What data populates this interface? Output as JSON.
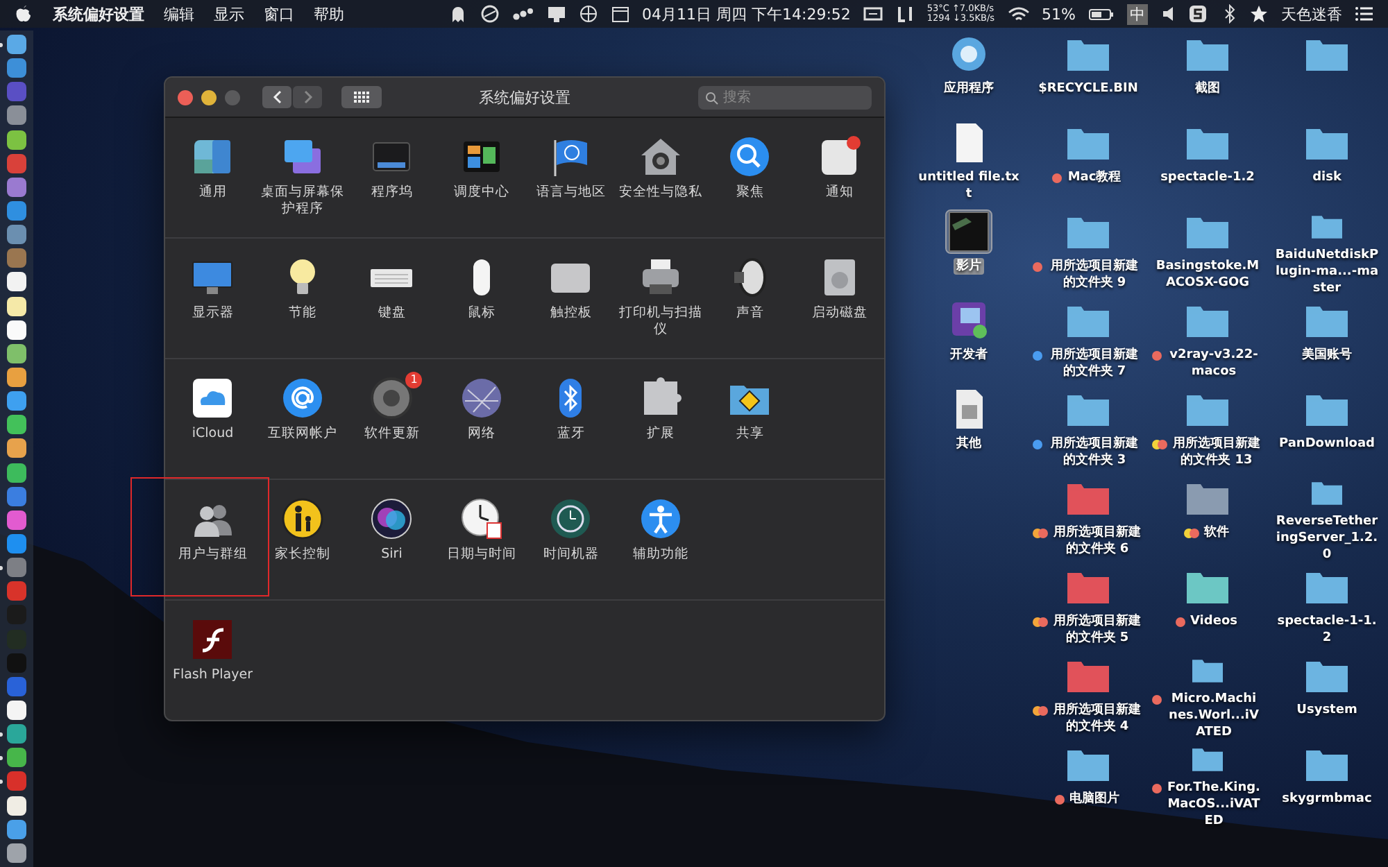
{
  "menu_bar": {
    "menus": [
      "系统偏好设置",
      "编辑",
      "显示",
      "窗口",
      "帮助"
    ],
    "date_time": "04月11日 周四 下午14:29:52",
    "temperature": "53°C",
    "upload": "↑7.0KB/s",
    "fan_speed": "1294",
    "download": "↓3.5KB/s",
    "battery": "51%",
    "input_method": "中",
    "user": "天色迷香"
  },
  "dock": {
    "items": [
      {
        "color": "#5aa9e6",
        "running": true
      },
      {
        "color": "#3d8fd8",
        "running": false
      },
      {
        "color": "#5a4fc4",
        "running": false
      },
      {
        "color": "#8a8f98",
        "running": false
      },
      {
        "color": "#7cc242",
        "running": false
      },
      {
        "color": "#d9413a",
        "running": false
      },
      {
        "color": "#9a7ad0",
        "running": false
      },
      {
        "color": "#2f8fe0",
        "running": false
      },
      {
        "color": "#6b8fb0",
        "running": false
      },
      {
        "color": "#9a7650",
        "running": false
      },
      {
        "color": "#f2f2f2",
        "running": false
      },
      {
        "color": "#f5e9a8",
        "running": false
      },
      {
        "color": "#fafafa",
        "running": false
      },
      {
        "color": "#7fbf6a",
        "running": false
      },
      {
        "color": "#e8a040",
        "running": false
      },
      {
        "color": "#3ea0f0",
        "running": false
      },
      {
        "color": "#43c15a",
        "running": false
      },
      {
        "color": "#e7a24c",
        "running": false
      },
      {
        "color": "#3dbb5c",
        "running": false
      },
      {
        "color": "#3b7ee0",
        "running": false
      },
      {
        "color": "#e25bd0",
        "running": false
      },
      {
        "color": "#1e8ff0",
        "running": false
      },
      {
        "color": "#7d7f85",
        "running": true
      },
      {
        "color": "#d8332a",
        "running": false
      },
      {
        "color": "#1b1b1b",
        "running": false
      },
      {
        "color": "#222d22",
        "running": false
      },
      {
        "color": "#111111",
        "running": false
      },
      {
        "color": "#2962d8",
        "running": false
      },
      {
        "color": "#f4f4f4",
        "running": false
      },
      {
        "color": "#2aa79a",
        "running": true
      },
      {
        "color": "#47b64a",
        "running": true
      },
      {
        "color": "#d8302a",
        "running": true
      },
      {
        "color": "#f0ede4",
        "running": false
      },
      {
        "color": "#4aa0e8",
        "running": false
      },
      {
        "color": "#9ea3aa",
        "running": false
      }
    ]
  },
  "window": {
    "title": "系统偏好设置",
    "traffic_lights": [
      {
        "color": "#ec5f57"
      },
      {
        "color": "#e0b33a"
      },
      {
        "color": "#5a5a5c"
      }
    ],
    "nav_buttons": [
      {
        "kind": "back",
        "disabled": false
      },
      {
        "kind": "forward",
        "disabled": true
      }
    ],
    "search": {
      "placeholder": "搜索"
    },
    "sections": [
      {
        "items": [
          {
            "label": "通用",
            "annotated": false
          },
          {
            "label": "桌面与屏幕保护程序",
            "annotated": false
          },
          {
            "label": "程序坞",
            "annotated": false
          },
          {
            "label": "调度中心",
            "annotated": false
          },
          {
            "label": "语言与地区",
            "annotated": false
          },
          {
            "label": "安全性与隐私",
            "annotated": false
          },
          {
            "label": "聚焦",
            "annotated": false
          },
          {
            "label": "通知",
            "annotated": false
          }
        ]
      },
      {
        "items": [
          {
            "label": "显示器",
            "annotated": false
          },
          {
            "label": "节能",
            "annotated": false
          },
          {
            "label": "键盘",
            "annotated": false
          },
          {
            "label": "鼠标",
            "annotated": false
          },
          {
            "label": "触控板",
            "annotated": false
          },
          {
            "label": "打印机与扫描仪",
            "annotated": false
          },
          {
            "label": "声音",
            "annotated": false
          },
          {
            "label": "启动磁盘",
            "annotated": false
          }
        ]
      },
      {
        "items": [
          {
            "label": "iCloud",
            "annotated": false
          },
          {
            "label": "互联网帐户",
            "annotated": false
          },
          {
            "label": "软件更新",
            "badge": "1",
            "annotated": false
          },
          {
            "label": "网络",
            "annotated": false
          },
          {
            "label": "蓝牙",
            "annotated": false
          },
          {
            "label": "扩展",
            "annotated": false
          },
          {
            "label": "共享",
            "annotated": false
          }
        ]
      },
      {
        "items": [
          {
            "label": "用户与群组",
            "annotated": true
          },
          {
            "label": "家长控制",
            "annotated": false
          },
          {
            "label": "Siri",
            "annotated": false
          },
          {
            "label": "日期与时间",
            "annotated": false
          },
          {
            "label": "时间机器",
            "annotated": false
          },
          {
            "label": "辅助功能",
            "annotated": false
          }
        ]
      },
      {
        "items": [
          {
            "label": "Flash Player",
            "annotated": false
          }
        ]
      }
    ]
  },
  "desktop": {
    "columns": [
      {
        "items": [
          {
            "kind": "applications",
            "label": "应用程序",
            "selected": false
          },
          {
            "kind": "text-file",
            "label": "untitled file.txt",
            "selected": false
          },
          {
            "kind": "movie",
            "label": "影片",
            "selected": true
          },
          {
            "kind": "developer",
            "label": "开发者",
            "selected": false
          },
          {
            "kind": "document",
            "label": "其他",
            "selected": false
          }
        ]
      },
      {
        "items": [
          {
            "kind": "folder",
            "color": "#6cb4e0",
            "label": "$RECYCLE.BIN",
            "selected": false
          },
          {
            "kind": "folder",
            "color": "#6cb4e0",
            "label": "Mac教程",
            "selected": false,
            "tags": [
              {
                "color": "#ea6a5e"
              }
            ]
          },
          {
            "kind": "folder",
            "color": "#6cb4e0",
            "label": "用所选项目新建的文件夹 9",
            "selected": false,
            "tags": [
              {
                "color": "#ea6a5e"
              }
            ]
          },
          {
            "kind": "folder",
            "color": "#6cb4e0",
            "label": "用所选项目新建的文件夹 7",
            "selected": false,
            "tags": [
              {
                "color": "#4a9cf0"
              }
            ]
          },
          {
            "kind": "folder",
            "color": "#6cb4e0",
            "label": "用所选项目新建的文件夹 3",
            "selected": false,
            "tags": [
              {
                "color": "#4a9cf0"
              }
            ]
          },
          {
            "kind": "folder",
            "color": "#e0525a",
            "label": "用所选项目新建的文件夹 6",
            "selected": false,
            "tags": [
              {
                "color": "#f2a53a"
              },
              {
                "color": "#ea6a5e"
              }
            ]
          },
          {
            "kind": "folder",
            "color": "#e0525a",
            "label": "用所选项目新建的文件夹 5",
            "selected": false,
            "tags": [
              {
                "color": "#f2a53a"
              },
              {
                "color": "#ea6a5e"
              }
            ]
          },
          {
            "kind": "folder",
            "color": "#e0525a",
            "label": "用所选项目新建的文件夹 4",
            "selected": false,
            "tags": [
              {
                "color": "#f2a53a"
              },
              {
                "color": "#ea6a5e"
              }
            ]
          },
          {
            "kind": "folder",
            "color": "#6cb4e0",
            "label": "电脑图片",
            "selected": false,
            "tags": [
              {
                "color": "#ea6a5e"
              }
            ]
          }
        ]
      },
      {
        "items": [
          {
            "kind": "folder",
            "color": "#6cb4e0",
            "label": "截图",
            "selected": false
          },
          {
            "kind": "folder",
            "color": "#6cb4e0",
            "label": "spectacle-1.2",
            "selected": false
          },
          {
            "kind": "folder",
            "color": "#6cb4e0",
            "label": "Basingstoke.MACOSX-GOG",
            "selected": false
          },
          {
            "kind": "folder",
            "color": "#6cb4e0",
            "label": "v2ray-v3.22-macos",
            "selected": false,
            "tags": [
              {
                "color": "#ea6a5e"
              }
            ]
          },
          {
            "kind": "folder",
            "color": "#6cb4e0",
            "label": "用所选项目新建的文件夹 13",
            "selected": false,
            "tags": [
              {
                "color": "#f2d23a"
              },
              {
                "color": "#ea6a5e"
              }
            ]
          },
          {
            "kind": "folder",
            "color": "#8a9bb0",
            "label": "软件",
            "selected": false,
            "tags": [
              {
                "color": "#f2d23a"
              },
              {
                "color": "#ea6a5e"
              }
            ]
          },
          {
            "kind": "folder",
            "color": "#6cc7c4",
            "label": "Videos",
            "selected": false,
            "tags": [
              {
                "color": "#ea6a5e"
              }
            ]
          },
          {
            "kind": "folder",
            "color": "#6cb4e0",
            "label": "Micro.Machines.Worl...iVATED",
            "selected": false,
            "tags": [
              {
                "color": "#ea6a5e"
              }
            ]
          },
          {
            "kind": "folder",
            "color": "#6cb4e0",
            "label": "For.The.King.MacOS...iVATED",
            "selected": false,
            "tags": [
              {
                "color": "#ea6a5e"
              }
            ]
          }
        ]
      },
      {
        "items": [
          {
            "kind": "folder",
            "color": "#6cb4e0",
            "selected": false
          },
          {
            "kind": "folder",
            "color": "#6cb4e0",
            "label": "disk",
            "selected": false
          },
          {
            "kind": "folder",
            "color": "#6cb4e0",
            "label": "BaiduNetdiskPlugin-ma...-master",
            "selected": false
          },
          {
            "kind": "folder",
            "color": "#6cb4e0",
            "label": "美国账号",
            "selected": false
          },
          {
            "kind": "folder",
            "color": "#6cb4e0",
            "label": "PanDownload",
            "selected": false
          },
          {
            "kind": "folder",
            "color": "#6cb4e0",
            "label": "ReverseTetheringServer_1.2.0",
            "selected": false
          },
          {
            "kind": "folder",
            "color": "#6cb4e0",
            "label": "spectacle-1-1.2",
            "selected": false
          },
          {
            "kind": "folder",
            "color": "#6cb4e0",
            "label": "Usystem",
            "selected": false
          },
          {
            "kind": "folder",
            "color": "#6cb4e0",
            "label": "skygrmbmac",
            "selected": false
          }
        ]
      }
    ]
  }
}
